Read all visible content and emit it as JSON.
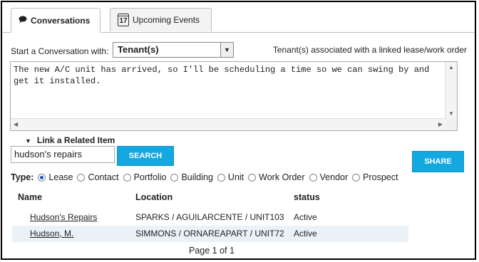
{
  "tabs": [
    {
      "label": "Conversations",
      "icon": "speech-bubble-icon",
      "active": true
    },
    {
      "label": "Upcoming Events",
      "icon": "calendar-icon",
      "calendar_day": "17",
      "active": false
    }
  ],
  "conversation": {
    "start_label": "Start a Conversation with:",
    "recipient_selected": "Tenant(s)",
    "note": "Tenant(s) associated with a linked lease/work order",
    "message": "The new A/C unit has arrived, so I'll be scheduling a time so we can swing by and get it installed."
  },
  "link_related": {
    "label": "Link a Related Item",
    "search_value": "hudson's repairs",
    "search_button": "SEARCH",
    "share_button": "SHARE"
  },
  "type_filter": {
    "label": "Type:",
    "options": [
      "Lease",
      "Contact",
      "Portfolio",
      "Building",
      "Unit",
      "Work Order",
      "Vendor",
      "Prospect"
    ],
    "selected": "Lease"
  },
  "results": {
    "columns": [
      "Name",
      "Location",
      "status"
    ],
    "rows": [
      {
        "name": "Hudson's Repairs",
        "location": "SPARKS / AGUILARCENTE / UNIT103",
        "status": "Active"
      },
      {
        "name": "Hudson, M.",
        "location": "SIMMONS / ORNAREAPART / UNIT72",
        "status": "Active"
      }
    ],
    "pager": "Page 1 of 1"
  },
  "colors": {
    "accent": "#13a8df",
    "row_alt": "#eaf1f7",
    "radio_selected": "#1a4fd0"
  }
}
